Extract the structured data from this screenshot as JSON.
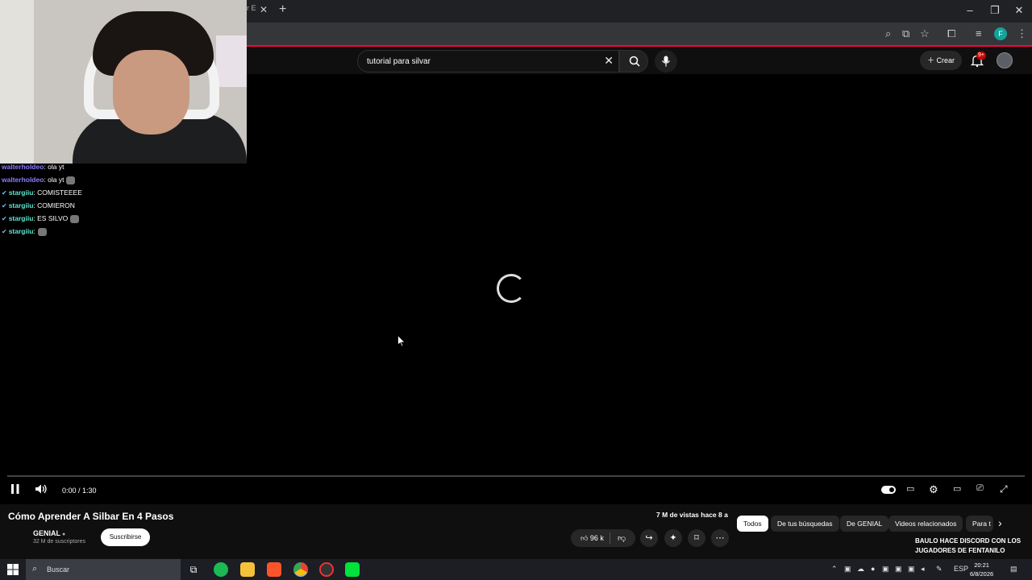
{
  "browser": {
    "tab_partial": "r E",
    "close_glyph": "✕",
    "new_tab_glyph": "+",
    "profile_letter": "F"
  },
  "youtube": {
    "search": {
      "value": "tutorial para silvar"
    },
    "create_label": "Crear",
    "notification_count": "9+"
  },
  "chat": [
    {
      "user": "walterholdeo",
      "message": ": ola yt",
      "color": "purple",
      "badge": false
    },
    {
      "user": "walterholdeo",
      "message": ": ola yt",
      "color": "purple",
      "badge": false,
      "emote": true
    },
    {
      "user": "stargiiu",
      "message": ": COMISTEEEE",
      "color": "teal",
      "badge": true
    },
    {
      "user": "stargiiu",
      "message": ": COMIERON",
      "color": "teal",
      "badge": true
    },
    {
      "user": "stargiiu",
      "message": ": ES SILVO",
      "color": "teal",
      "badge": true,
      "emote": true
    },
    {
      "user": "stargiiu",
      "message": ":",
      "color": "teal",
      "badge": true,
      "emote": true
    }
  ],
  "player": {
    "time": "0:00 / 1:30",
    "progress_fraction": 0
  },
  "video": {
    "title": "Cómo Aprender A Silbar En 4 Pasos",
    "channel": "GENIAL",
    "subscribers": "32 M de suscriptores",
    "subscribe_label": "Suscribirse",
    "meta": "7 M de vistas  hace 8 a",
    "likes": "96 k"
  },
  "chips": [
    "Todos",
    "De tus búsquedas",
    "De GENIAL",
    "Videos relacionados",
    "Para t"
  ],
  "recommendation_title": "BAULO HACE DISCORD CON LOS JUGADORES DE FENTANILO",
  "taskbar": {
    "search_label": "Buscar",
    "language": "ESP",
    "time": "20:21",
    "date": "6/8/2026"
  },
  "colors": {
    "accent_red": "#ff0049",
    "chat_purple": "#8d7cff",
    "chat_teal": "#5fe7d0"
  }
}
